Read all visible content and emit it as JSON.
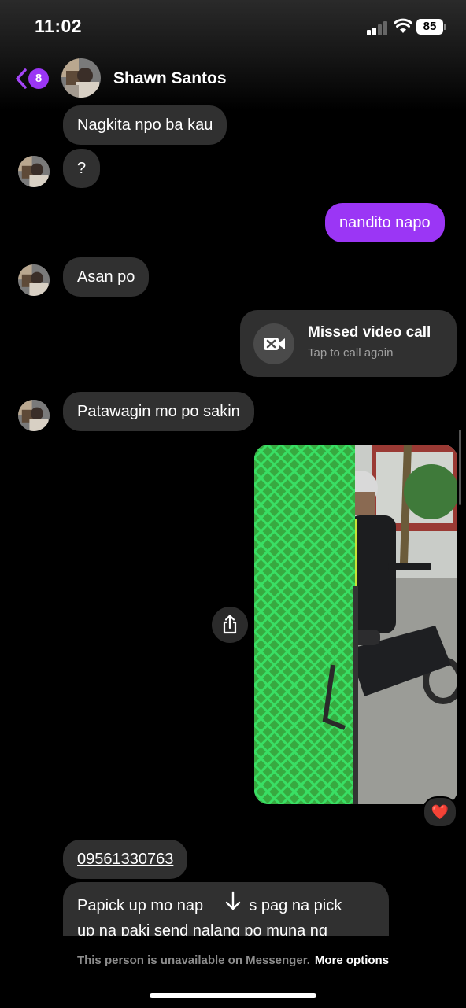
{
  "status_bar": {
    "time": "11:02",
    "battery": "85"
  },
  "header": {
    "back_count": "8",
    "contact_name": "Shawn Santos"
  },
  "messages": {
    "m1": "Nagkita npo ba kau",
    "m2": "?",
    "m3": "nandito napo",
    "m4": "Asan po",
    "m5": "Patawagin mo po sakin",
    "m6": "09561330763",
    "m7_line1": "Papick up mo nap",
    "m7_line1b": "pos pag na pick",
    "m7_line2": "up na  paki send nalang po muna ng"
  },
  "missed_call": {
    "title": "Missed video call",
    "subtitle": "Tap to call again"
  },
  "reaction": "❤️",
  "footer": {
    "notice": "This person is unavailable on Messenger.",
    "link": "More options"
  },
  "colors": {
    "accent": "#9b36f5",
    "incoming_bubble": "#303030",
    "background": "#000000"
  }
}
